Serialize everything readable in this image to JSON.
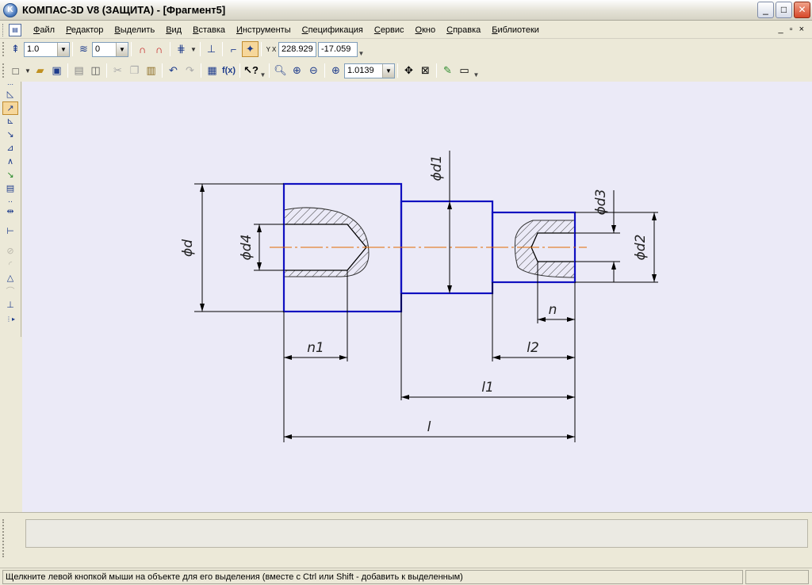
{
  "window": {
    "title": "КОМПАС-3D V8 (ЗАЩИТА) - [Фрагмент5]",
    "logo_letter": "K",
    "controls": {
      "minimize": "_",
      "maximize": "□",
      "close": "✕"
    }
  },
  "menubar": {
    "items": [
      "Файл",
      "Редактор",
      "Выделить",
      "Вид",
      "Вставка",
      "Инструменты",
      "Спецификация",
      "Сервис",
      "Окно",
      "Справка",
      "Библиотеки"
    ],
    "mdi_controls": {
      "minimize": "_",
      "restore": "▫",
      "close": "×"
    }
  },
  "toolbar_params": {
    "step_value": "1.0",
    "layer_value": "0",
    "cursor_x": "228.929",
    "cursor_y": "-17.059",
    "coord_label": "Y X"
  },
  "toolbar_std": {
    "zoom_value": "1.0139"
  },
  "drawing": {
    "labels": {
      "d": "ϕd",
      "d1": "ϕd1",
      "d2": "ϕd2",
      "d3": "ϕd3",
      "d4": "ϕd4",
      "n": "n",
      "n1": "n1",
      "l": "l",
      "l1": "l1",
      "l2": "l2"
    },
    "colors": {
      "outline": "#1010c0",
      "dimension": "#000000",
      "axis": "#e06a00",
      "background": "#ebeaf7"
    }
  },
  "statusbar": {
    "hint": "Щелкните левой кнопкой мыши на объекте для его выделения (вместе с Ctrl или Shift - добавить к выделенным)"
  }
}
